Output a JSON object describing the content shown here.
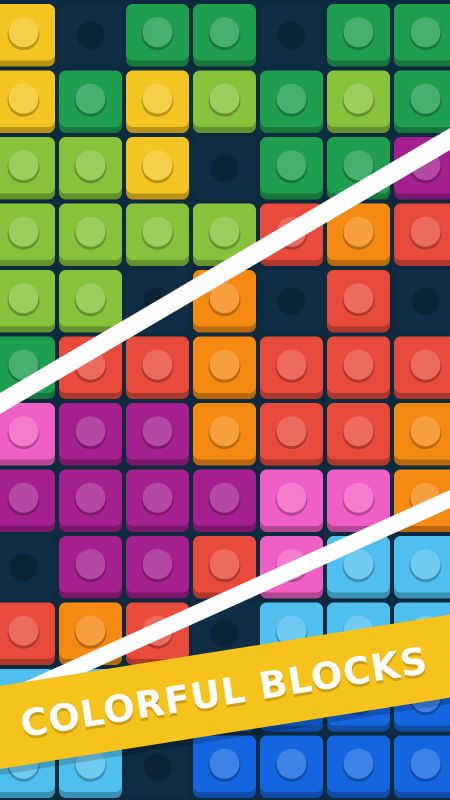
{
  "banner": {
    "text": "COLORFUL BLOCKS"
  },
  "palette": {
    "yellow": "#f4c520",
    "darkgreen": "#1e9e4f",
    "lime": "#86c23a",
    "red": "#e84a3b",
    "orange": "#f58a12",
    "magenta": "#a5208f",
    "pink": "#f05fc4",
    "lightblue": "#4fc0ee",
    "blue": "#1466e0",
    "empty": "#0f2d44",
    "background": "#0d2a3f",
    "divider": "#ffffff",
    "banner": "#f6c21c"
  },
  "grid": [
    [
      "yellow",
      "empty",
      "darkgreen",
      "darkgreen",
      "empty",
      "darkgreen",
      "darkgreen"
    ],
    [
      "yellow",
      "darkgreen",
      "yellow",
      "lime",
      "darkgreen",
      "lime",
      "darkgreen"
    ],
    [
      "lime",
      "lime",
      "yellow",
      "empty",
      "darkgreen",
      "darkgreen",
      "magenta"
    ],
    [
      "lime",
      "lime",
      "lime",
      "lime",
      "red",
      "orange",
      "red"
    ],
    [
      "lime",
      "lime",
      "empty",
      "orange",
      "empty",
      "red",
      "empty"
    ],
    [
      "darkgreen",
      "red",
      "red",
      "orange",
      "red",
      "red",
      "red"
    ],
    [
      "pink",
      "magenta",
      "magenta",
      "orange",
      "red",
      "red",
      "orange"
    ],
    [
      "magenta",
      "magenta",
      "magenta",
      "magenta",
      "pink",
      "pink",
      "orange"
    ],
    [
      "empty",
      "magenta",
      "magenta",
      "red",
      "pink",
      "lightblue",
      "lightblue"
    ],
    [
      "red",
      "orange",
      "red",
      "empty",
      "lightblue",
      "lightblue",
      "lightblue"
    ],
    [
      "lightblue",
      "lightblue",
      "empty",
      "blue",
      "blue",
      "blue",
      "blue"
    ],
    [
      "lightblue",
      "lightblue",
      "empty",
      "blue",
      "blue",
      "blue",
      "blue"
    ]
  ]
}
